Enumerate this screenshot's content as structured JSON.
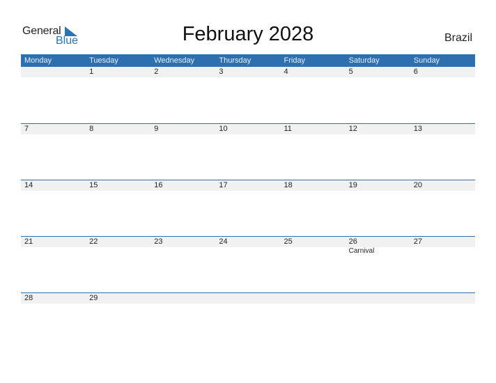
{
  "logo": {
    "text_general": "General",
    "text_blue": "Blue",
    "icon": "flag-triangle-icon"
  },
  "title": "February 2028",
  "country": "Brazil",
  "colors": {
    "accent": "#2e6fb0",
    "day_bar": "#f1f1f1"
  },
  "weekdays": [
    "Monday",
    "Tuesday",
    "Wednesday",
    "Thursday",
    "Friday",
    "Saturday",
    "Sunday"
  ],
  "weeks": [
    {
      "days": [
        {
          "num": "",
          "event": ""
        },
        {
          "num": "1",
          "event": ""
        },
        {
          "num": "2",
          "event": ""
        },
        {
          "num": "3",
          "event": ""
        },
        {
          "num": "4",
          "event": ""
        },
        {
          "num": "5",
          "event": ""
        },
        {
          "num": "6",
          "event": ""
        }
      ]
    },
    {
      "days": [
        {
          "num": "7",
          "event": ""
        },
        {
          "num": "8",
          "event": ""
        },
        {
          "num": "9",
          "event": ""
        },
        {
          "num": "10",
          "event": ""
        },
        {
          "num": "11",
          "event": ""
        },
        {
          "num": "12",
          "event": ""
        },
        {
          "num": "13",
          "event": ""
        }
      ]
    },
    {
      "days": [
        {
          "num": "14",
          "event": ""
        },
        {
          "num": "15",
          "event": ""
        },
        {
          "num": "16",
          "event": ""
        },
        {
          "num": "17",
          "event": ""
        },
        {
          "num": "18",
          "event": ""
        },
        {
          "num": "19",
          "event": ""
        },
        {
          "num": "20",
          "event": ""
        }
      ]
    },
    {
      "days": [
        {
          "num": "21",
          "event": ""
        },
        {
          "num": "22",
          "event": ""
        },
        {
          "num": "23",
          "event": ""
        },
        {
          "num": "24",
          "event": ""
        },
        {
          "num": "25",
          "event": ""
        },
        {
          "num": "26",
          "event": "Carnival"
        },
        {
          "num": "27",
          "event": ""
        }
      ]
    },
    {
      "days": [
        {
          "num": "28",
          "event": ""
        },
        {
          "num": "29",
          "event": ""
        },
        {
          "num": "",
          "event": ""
        },
        {
          "num": "",
          "event": ""
        },
        {
          "num": "",
          "event": ""
        },
        {
          "num": "",
          "event": ""
        },
        {
          "num": "",
          "event": ""
        }
      ]
    }
  ]
}
